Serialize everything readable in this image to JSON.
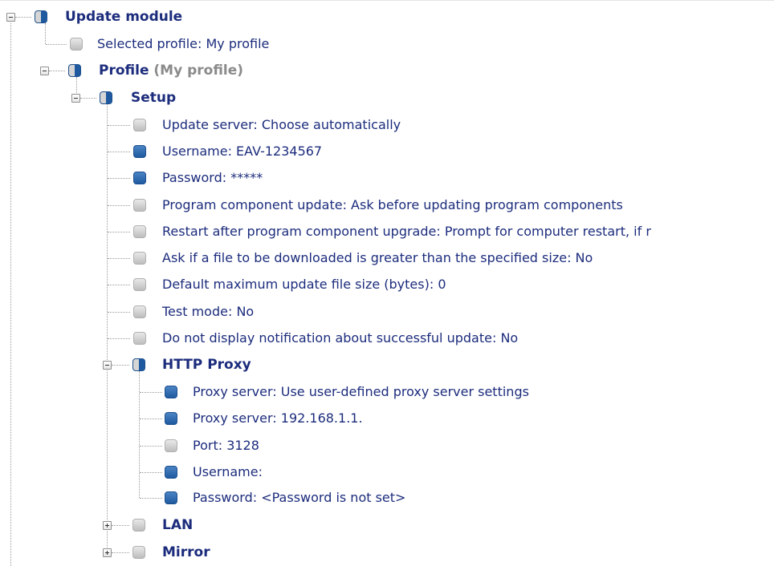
{
  "colors": {
    "text": "#1c2c7c",
    "muted": "#8a8a8a",
    "blue": "#1f5aa0",
    "grey": "#c4c4c4",
    "line": "#9a9a9a"
  },
  "tree": {
    "root": {
      "label": "Update module",
      "icon": "half-blue-circle-icon"
    },
    "selected_profile": {
      "label": "Selected profile: My profile",
      "icon": "grey-circle-icon"
    },
    "profile": {
      "label": "Profile",
      "sub": "(My profile)",
      "icon": "half-blue-circle-icon"
    },
    "setup": {
      "label": "Setup",
      "icon": "half-blue-circle-icon"
    },
    "setup_items": [
      {
        "label": "Update server: Choose automatically",
        "icon": "grey-circle-icon"
      },
      {
        "label": "Username: EAV-1234567",
        "icon": "blue-circle-icon"
      },
      {
        "label": "Password: *****",
        "icon": "blue-circle-icon"
      },
      {
        "label": "Program component update: Ask before updating program components",
        "icon": "grey-circle-icon"
      },
      {
        "label": "Restart after program component upgrade: Prompt for computer restart, if r",
        "icon": "grey-circle-icon"
      },
      {
        "label": "Ask if a file to be downloaded is greater than the specified size: No",
        "icon": "grey-circle-icon"
      },
      {
        "label": "Default maximum update file size (bytes): 0",
        "icon": "grey-circle-icon"
      },
      {
        "label": "Test mode: No",
        "icon": "grey-circle-icon"
      },
      {
        "label": "Do not display notification about successful update: No",
        "icon": "grey-circle-icon"
      }
    ],
    "http_proxy": {
      "label": "HTTP Proxy",
      "icon": "half-blue-circle-icon"
    },
    "proxy_items": [
      {
        "label": "Proxy server: Use user-defined proxy server settings",
        "icon": "blue-circle-icon"
      },
      {
        "label": "Proxy server: 192.168.1.1.",
        "icon": "blue-circle-icon"
      },
      {
        "label": "Port: 3128",
        "icon": "grey-circle-icon"
      },
      {
        "label": "Username:",
        "icon": "blue-circle-icon"
      },
      {
        "label": "Password: <Password is not set>",
        "icon": "blue-circle-icon"
      }
    ],
    "lan": {
      "label": "LAN",
      "icon": "grey-circle-icon"
    },
    "mirror": {
      "label": "Mirror",
      "icon": "grey-circle-icon"
    }
  }
}
